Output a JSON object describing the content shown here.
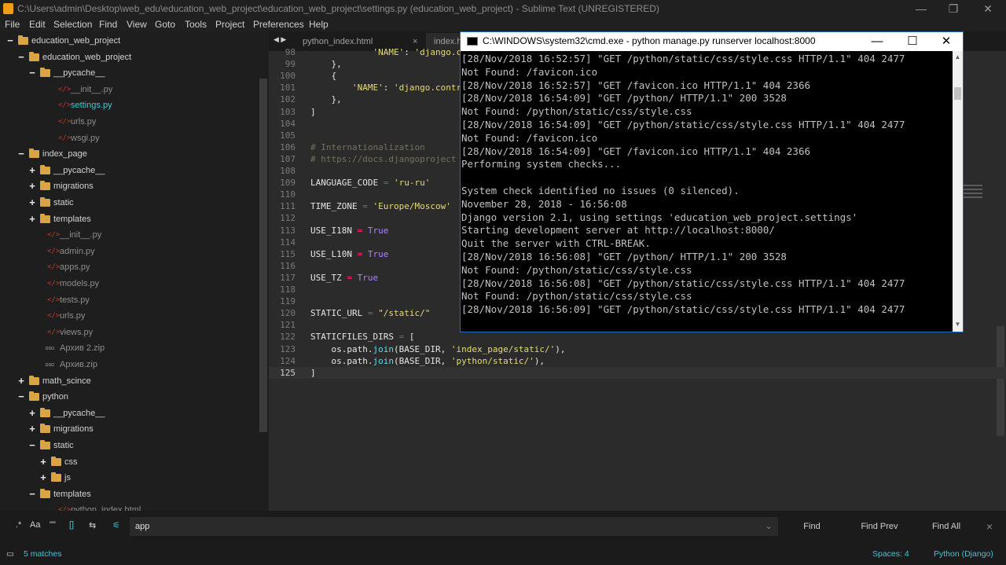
{
  "window": {
    "title": "C:\\Users\\admin\\Desktop\\web_edu\\education_web_project\\education_web_project\\settings.py (education_web_project) - Sublime Text (UNREGISTERED)",
    "minimize": "—",
    "maximize": "❐",
    "close": "✕"
  },
  "menu": [
    "File",
    "Edit",
    "Selection",
    "Find",
    "View",
    "Goto",
    "Tools",
    "Project",
    "Preferences",
    "Help"
  ],
  "sidebar": {
    "items": [
      {
        "label": "education_web_project",
        "type": "folder",
        "state": "open"
      },
      {
        "label": "education_web_project",
        "type": "folder",
        "state": "open"
      },
      {
        "label": "__pycache__",
        "type": "folder",
        "state": "open"
      },
      {
        "label": "__init__.py",
        "type": "file"
      },
      {
        "label": "settings.py",
        "type": "file",
        "active": true
      },
      {
        "label": "urls.py",
        "type": "file"
      },
      {
        "label": "wsgi.py",
        "type": "file"
      },
      {
        "label": "index_page",
        "type": "folder",
        "state": "open"
      },
      {
        "label": "__pycache__",
        "type": "folder",
        "state": "closed"
      },
      {
        "label": "migrations",
        "type": "folder",
        "state": "closed"
      },
      {
        "label": "static",
        "type": "folder",
        "state": "closed"
      },
      {
        "label": "templates",
        "type": "folder",
        "state": "closed"
      },
      {
        "label": "__init__.py",
        "type": "file"
      },
      {
        "label": "admin.py",
        "type": "file"
      },
      {
        "label": "apps.py",
        "type": "file"
      },
      {
        "label": "models.py",
        "type": "file"
      },
      {
        "label": "tests.py",
        "type": "file"
      },
      {
        "label": "urls.py",
        "type": "file"
      },
      {
        "label": "views.py",
        "type": "file"
      },
      {
        "label": "Архив 2.zip",
        "type": "zip"
      },
      {
        "label": "Архив.zip",
        "type": "zip"
      },
      {
        "label": "math_scince",
        "type": "folder",
        "state": "closed"
      },
      {
        "label": "python",
        "type": "folder",
        "state": "open"
      },
      {
        "label": "__pycache__",
        "type": "folder",
        "state": "closed"
      },
      {
        "label": "migrations",
        "type": "folder",
        "state": "closed"
      },
      {
        "label": "static",
        "type": "folder",
        "state": "open"
      },
      {
        "label": "css",
        "type": "folder",
        "state": "closed"
      },
      {
        "label": "js",
        "type": "folder",
        "state": "closed"
      },
      {
        "label": "templates",
        "type": "folder",
        "state": "open"
      },
      {
        "label": "python_index.html",
        "type": "file"
      }
    ]
  },
  "tabs": [
    {
      "label": "python_index.html",
      "close": "×"
    },
    {
      "label": "index.h",
      "close": ""
    }
  ],
  "editor": {
    "lines": [
      {
        "n": "98",
        "t": "            'NAME': 'django.contr"
      },
      {
        "n": "99",
        "t": "    },"
      },
      {
        "n": "100",
        "t": "    {"
      },
      {
        "n": "101",
        "t": "        'NAME': 'django.contr"
      },
      {
        "n": "102",
        "t": "    },"
      },
      {
        "n": "103",
        "t": "]"
      },
      {
        "n": "104",
        "t": ""
      },
      {
        "n": "105",
        "t": ""
      },
      {
        "n": "106",
        "t": "# Internationalization"
      },
      {
        "n": "107",
        "t": "# https://docs.djangoproject"
      },
      {
        "n": "108",
        "t": ""
      },
      {
        "n": "109",
        "t": "LANGUAGE_CODE = 'ru-ru'"
      },
      {
        "n": "110",
        "t": ""
      },
      {
        "n": "111",
        "t": "TIME_ZONE = 'Europe/Moscow'"
      },
      {
        "n": "112",
        "t": ""
      },
      {
        "n": "113",
        "t": "USE_I18N = True"
      },
      {
        "n": "114",
        "t": ""
      },
      {
        "n": "115",
        "t": "USE_L10N = True"
      },
      {
        "n": "116",
        "t": ""
      },
      {
        "n": "117",
        "t": "USE_TZ = True"
      },
      {
        "n": "118",
        "t": ""
      },
      {
        "n": "119",
        "t": ""
      },
      {
        "n": "120",
        "t": "STATIC_URL = \"/static/\""
      },
      {
        "n": "121",
        "t": ""
      },
      {
        "n": "122",
        "t": "STATICFILES_DIRS = ["
      },
      {
        "n": "123",
        "t": "    os.path.join(BASE_DIR, 'index_page/static/'),"
      },
      {
        "n": "124",
        "t": "    os.path.join(BASE_DIR, 'python/static/'),"
      },
      {
        "n": "125",
        "t": "]"
      }
    ]
  },
  "cmd": {
    "title": "C:\\WINDOWS\\system32\\cmd.exe - python  manage.py runserver localhost:8000",
    "minimize": "—",
    "maximize": "☐",
    "close": "✕",
    "lines": [
      "[28/Nov/2018 16:52:57] \"GET /python/static/css/style.css HTTP/1.1\" 404 2477",
      "Not Found: /favicon.ico",
      "[28/Nov/2018 16:52:57] \"GET /favicon.ico HTTP/1.1\" 404 2366",
      "[28/Nov/2018 16:54:09] \"GET /python/ HTTP/1.1\" 200 3528",
      "Not Found: /python/static/css/style.css",
      "[28/Nov/2018 16:54:09] \"GET /python/static/css/style.css HTTP/1.1\" 404 2477",
      "Not Found: /favicon.ico",
      "[28/Nov/2018 16:54:09] \"GET /favicon.ico HTTP/1.1\" 404 2366",
      "Performing system checks...",
      "",
      "System check identified no issues (0 silenced).",
      "November 28, 2018 - 16:56:08",
      "Django version 2.1, using settings 'education_web_project.settings'",
      "Starting development server at http://localhost:8000/",
      "Quit the server with CTRL-BREAK.",
      "[28/Nov/2018 16:56:08] \"GET /python/ HTTP/1.1\" 200 3528",
      "Not Found: /python/static/css/style.css",
      "[28/Nov/2018 16:56:08] \"GET /python/static/css/style.css HTTP/1.1\" 404 2477",
      "Not Found: /python/static/css/style.css",
      "[28/Nov/2018 16:56:09] \"GET /python/static/css/style.css HTTP/1.1\" 404 2477"
    ]
  },
  "find": {
    "value": "app",
    "find_label": "Find",
    "find_prev_label": "Find Prev",
    "find_all_label": "Find All",
    "dropdown": "⌄",
    "close": "×",
    "options": [
      ".*",
      "Aa",
      "\"\"",
      "[]",
      "⇆",
      "⚟"
    ]
  },
  "status": {
    "matches": "5 matches",
    "spaces": "Spaces: 4",
    "syntax": "Python (Django)"
  },
  "colors": {
    "accent": "#3fc7d6",
    "folder": "#d9a441",
    "file_icon": "#c0392b",
    "string": "#e6db74",
    "keyword": "#ae81ff",
    "comment": "#75715e"
  }
}
